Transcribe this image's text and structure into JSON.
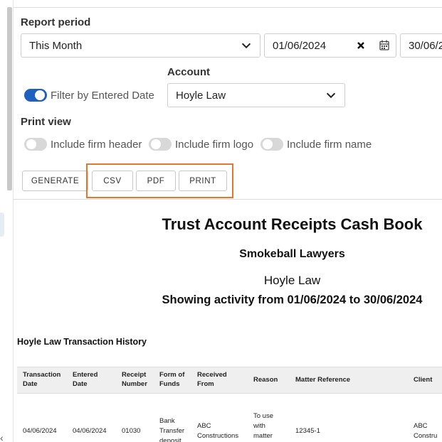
{
  "filters": {
    "report_period_label": "Report period",
    "report_period_value": "This Month",
    "date_from": "01/06/2024",
    "date_to": "30/06/2",
    "filter_by_entered_date_label": "Filter by Entered Date",
    "filter_by_entered_date_on": true,
    "account_label": "Account",
    "account_value": "Hoyle Law"
  },
  "print_view": {
    "label": "Print view",
    "include_firm_header": "Include firm header",
    "include_firm_logo": "Include firm logo",
    "include_firm_name": "Include firm name"
  },
  "actions": {
    "generate": "GENERATE",
    "csv": "CSV",
    "pdf": "PDF",
    "print": "PRINT"
  },
  "report": {
    "title": "Trust Account Receipts Cash Book",
    "firm": "Smokeball Lawyers",
    "account": "Hoyle Law",
    "activity_range": "Showing activity from 01/06/2024 to 30/06/2024",
    "history_title": "Hoyle Law Transaction History",
    "columns": {
      "transaction_date": [
        "Transaction",
        "Date"
      ],
      "entered_date": [
        "Entered",
        "Date"
      ],
      "receipt_number": [
        "Receipt",
        "Number"
      ],
      "form_of_funds": [
        "Form of",
        "Funds"
      ],
      "received_from": [
        "Received",
        "From"
      ],
      "reason": [
        "Reason"
      ],
      "matter_reference": [
        "Matter Reference"
      ],
      "client": [
        "Client"
      ]
    },
    "rows": [
      {
        "transaction_date": "04/06/2024",
        "entered_date": "04/06/2024",
        "receipt_number": "01030",
        "form_of_funds": [
          "Bank",
          "Transfer",
          "deposit"
        ],
        "received_from": [
          "ABC",
          "Constructions"
        ],
        "reason": [
          "To use",
          "with",
          "matter"
        ],
        "matter_reference": "12345-1",
        "client": [
          "ABC",
          "Constru"
        ]
      }
    ]
  },
  "colors": {
    "accent_toggle": "#1e5fbf",
    "highlight_border": "#e4772b"
  }
}
